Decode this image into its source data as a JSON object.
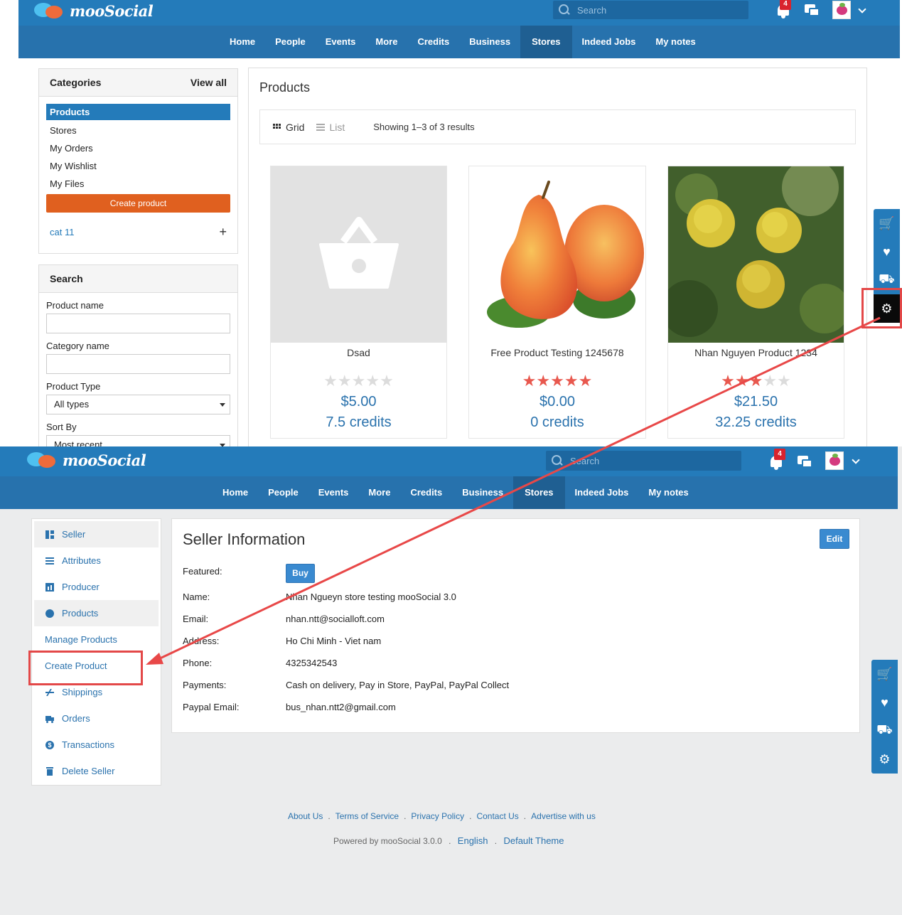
{
  "header": {
    "logo_text": "mooSocial",
    "search_placeholder": "Search",
    "notification_count": "4"
  },
  "nav": {
    "items": [
      "Home",
      "People",
      "Events",
      "More",
      "Credits",
      "Business",
      "Stores",
      "Indeed Jobs",
      "My notes"
    ],
    "active": "Stores"
  },
  "categories": {
    "title": "Categories",
    "view_all": "View all",
    "items": [
      "Products",
      "Stores",
      "My Orders",
      "My Wishlist",
      "My Files"
    ],
    "active": "Products",
    "create_button": "Create product",
    "cat_label": "cat 11",
    "expand_symbol": "+"
  },
  "search_panel": {
    "title": "Search",
    "product_name_label": "Product name",
    "category_name_label": "Category name",
    "product_type_label": "Product Type",
    "product_type_value": "All types",
    "sort_by_label": "Sort By",
    "sort_by_value": "Most recent"
  },
  "products": {
    "title": "Products",
    "view_grid": "Grid",
    "view_list": "List",
    "results_text": "Showing 1–3 of 3 results",
    "items": [
      {
        "name": "Dsad",
        "rating": 0,
        "price": "$5.00",
        "credits": "7.5 credits"
      },
      {
        "name": "Free Product Testing 1245678",
        "rating": 5,
        "price": "$0.00",
        "credits": "0 credits"
      },
      {
        "name": "Nhan Nguyen Product 1234",
        "rating": 3,
        "price": "$21.50",
        "credits": "32.25 credits"
      }
    ]
  },
  "seller_menu": {
    "items": [
      "Seller",
      "Attributes",
      "Producer",
      "Products",
      "Manage Products",
      "Create Product",
      "Shippings",
      "Orders",
      "Transactions",
      "Delete Seller"
    ]
  },
  "seller_info": {
    "title": "Seller Information",
    "edit_button": "Edit",
    "featured_label": "Featured:",
    "buy_button": "Buy",
    "fields": [
      {
        "label": "Name:",
        "value": "Nhan Ngueyn store testing mooSocial 3.0"
      },
      {
        "label": "Email:",
        "value": "nhan.ntt@socialloft.com"
      },
      {
        "label": "Address:",
        "value": "Ho Chi Minh - Viet nam"
      },
      {
        "label": "Phone:",
        "value": "4325342543"
      },
      {
        "label": "Payments:",
        "value": "Cash on delivery, Pay in Store, PayPal, PayPal Collect"
      },
      {
        "label": "Paypal Email:",
        "value": "bus_nhan.ntt2@gmail.com"
      }
    ]
  },
  "footer": {
    "links": [
      "About Us",
      "Terms of Service",
      "Privacy Policy",
      "Contact Us",
      "Advertise with us"
    ],
    "powered_by": "Powered by mooSocial 3.0.0",
    "language": "English",
    "theme": "Default Theme"
  },
  "colors": {
    "topbar": "#247bba",
    "navbar": "#2772ad",
    "accent_orange": "#e0601f",
    "highlight_red": "#e34848",
    "link_blue": "#2a72ad"
  }
}
